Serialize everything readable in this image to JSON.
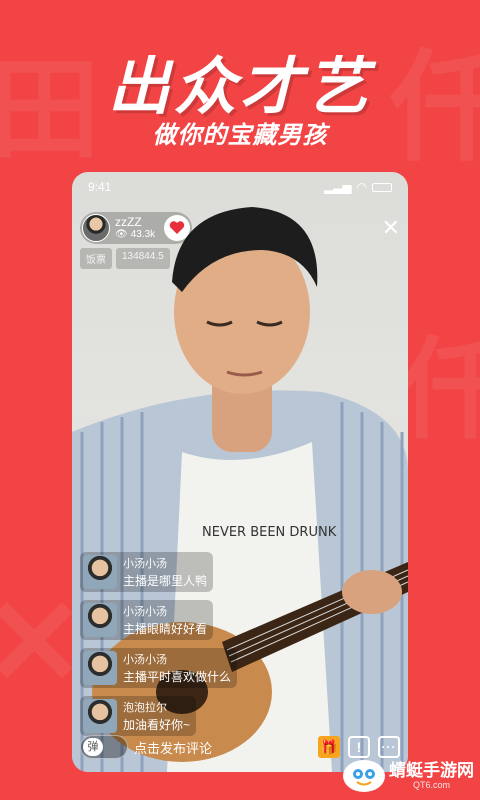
{
  "promo": {
    "headline": "出众才艺",
    "subhead": "做你的宝藏男孩"
  },
  "status_bar": {
    "time": "9:41"
  },
  "live": {
    "host_name": "zzZZ",
    "host_views": "43.3k",
    "coin_label": "饭票",
    "coin_value": "134844.5",
    "overlay_text": "NEVER BEEN DRUNK"
  },
  "comments": [
    {
      "user": "小汤小汤",
      "message": "主播是哪里人鸭"
    },
    {
      "user": "小汤小汤",
      "message": "主播眼睛好好看"
    },
    {
      "user": "小汤小汤",
      "message": "主播平时喜欢做什么"
    },
    {
      "user": "泡泡拉尔",
      "message": "加油看好你~"
    }
  ],
  "bottom_bar": {
    "danmaku_label": "弹",
    "comment_prompt": "点击发布评论"
  },
  "watermark": {
    "brand": "蜻蜓手游网",
    "url": "QT6.com"
  },
  "colors": {
    "background": "#f24444",
    "gift_accent": "#f7a51e",
    "heart": "#e8303d"
  }
}
